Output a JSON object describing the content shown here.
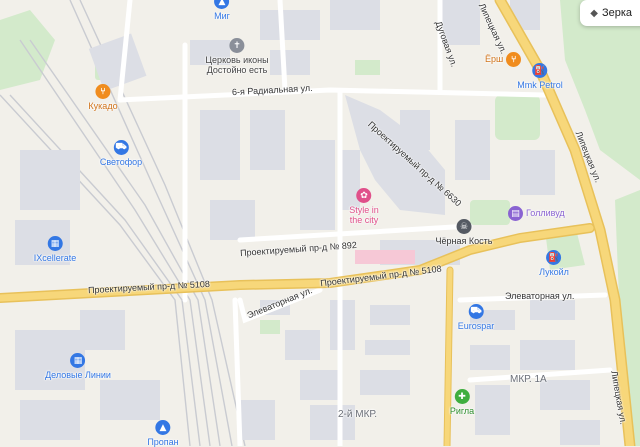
{
  "map_button": {
    "label": "Зеркало",
    "visible_text": "Зерка"
  },
  "streets": {
    "radialnaya": "6-я Радиальная ул.",
    "dugovaya": "Дуговая ул.",
    "lipetskaya_top": "Липецкая ул.",
    "lipetskaya_mid": "Липецкая ул.",
    "lipetskaya_bottom": "Липецкая ул.",
    "pr_6630": "Проектируемый пр-д № 6630",
    "pr_892": "Проектируемый пр-д № 892",
    "pr_5108_left": "Проектируемый пр-д № 5108",
    "pr_5108_right": "Проектируемый пр-д № 5108",
    "elevatornaya_left": "Элеваторная ул.",
    "elevatornaya_right": "Элеваторная ул."
  },
  "districts": {
    "mkr_1a": "МКР. 1А",
    "mkr_2": "2-й МКР."
  },
  "pois": {
    "mig": {
      "name": "Миг",
      "icon": "shopping-bag-icon",
      "color": "#3377e4"
    },
    "church": {
      "name": "Церковь иконы\nДостойно есть",
      "icon": "cross-icon",
      "color": "#8a8f99"
    },
    "kukado": {
      "name": "Кукадо",
      "icon": "cutlery-icon",
      "color": "#f08c1e"
    },
    "svetofor": {
      "name": "Светофор",
      "icon": "cart-icon",
      "color": "#3377e4"
    },
    "ixcellerate": {
      "name": "IXcellerate",
      "icon": "building-icon",
      "color": "#3377e4"
    },
    "delovye_linii": {
      "name": "Деловые Линии",
      "icon": "building-icon",
      "color": "#3377e4"
    },
    "propan": {
      "name": "Пропан",
      "icon": "shopping-bag-icon",
      "color": "#3377e4"
    },
    "yorsh": {
      "name": "Ёрш",
      "icon": "cutlery-icon",
      "color": "#f08c1e"
    },
    "mmk_petrol": {
      "name": "Mmk Petrol",
      "icon": "fuel-icon",
      "color": "#3377e4"
    },
    "style_in_the_city": {
      "name": "Style in\nthe city",
      "icon": "flower-icon",
      "color": "#e0508a"
    },
    "chernaya_kost": {
      "name": "Чёрная Кость",
      "icon": "skull-icon",
      "color": "#555a63"
    },
    "gollivud": {
      "name": "Голливуд",
      "icon": "cinema-icon",
      "color": "#8a63d2"
    },
    "lukoil": {
      "name": "Лукойл",
      "icon": "fuel-icon",
      "color": "#3377e4"
    },
    "eurospar": {
      "name": "Eurospar",
      "icon": "cart-icon",
      "color": "#3377e4"
    },
    "rigla": {
      "name": "Ригла",
      "icon": "pharmacy-icon",
      "color": "#3fae3f"
    }
  },
  "colors": {
    "land": "#f2f0ea",
    "building": "#dcdee5",
    "green": "#cfe9c8",
    "major_road": "#f7d77a",
    "minor_road": "#ffffff",
    "rail": "#c9cbd1"
  }
}
